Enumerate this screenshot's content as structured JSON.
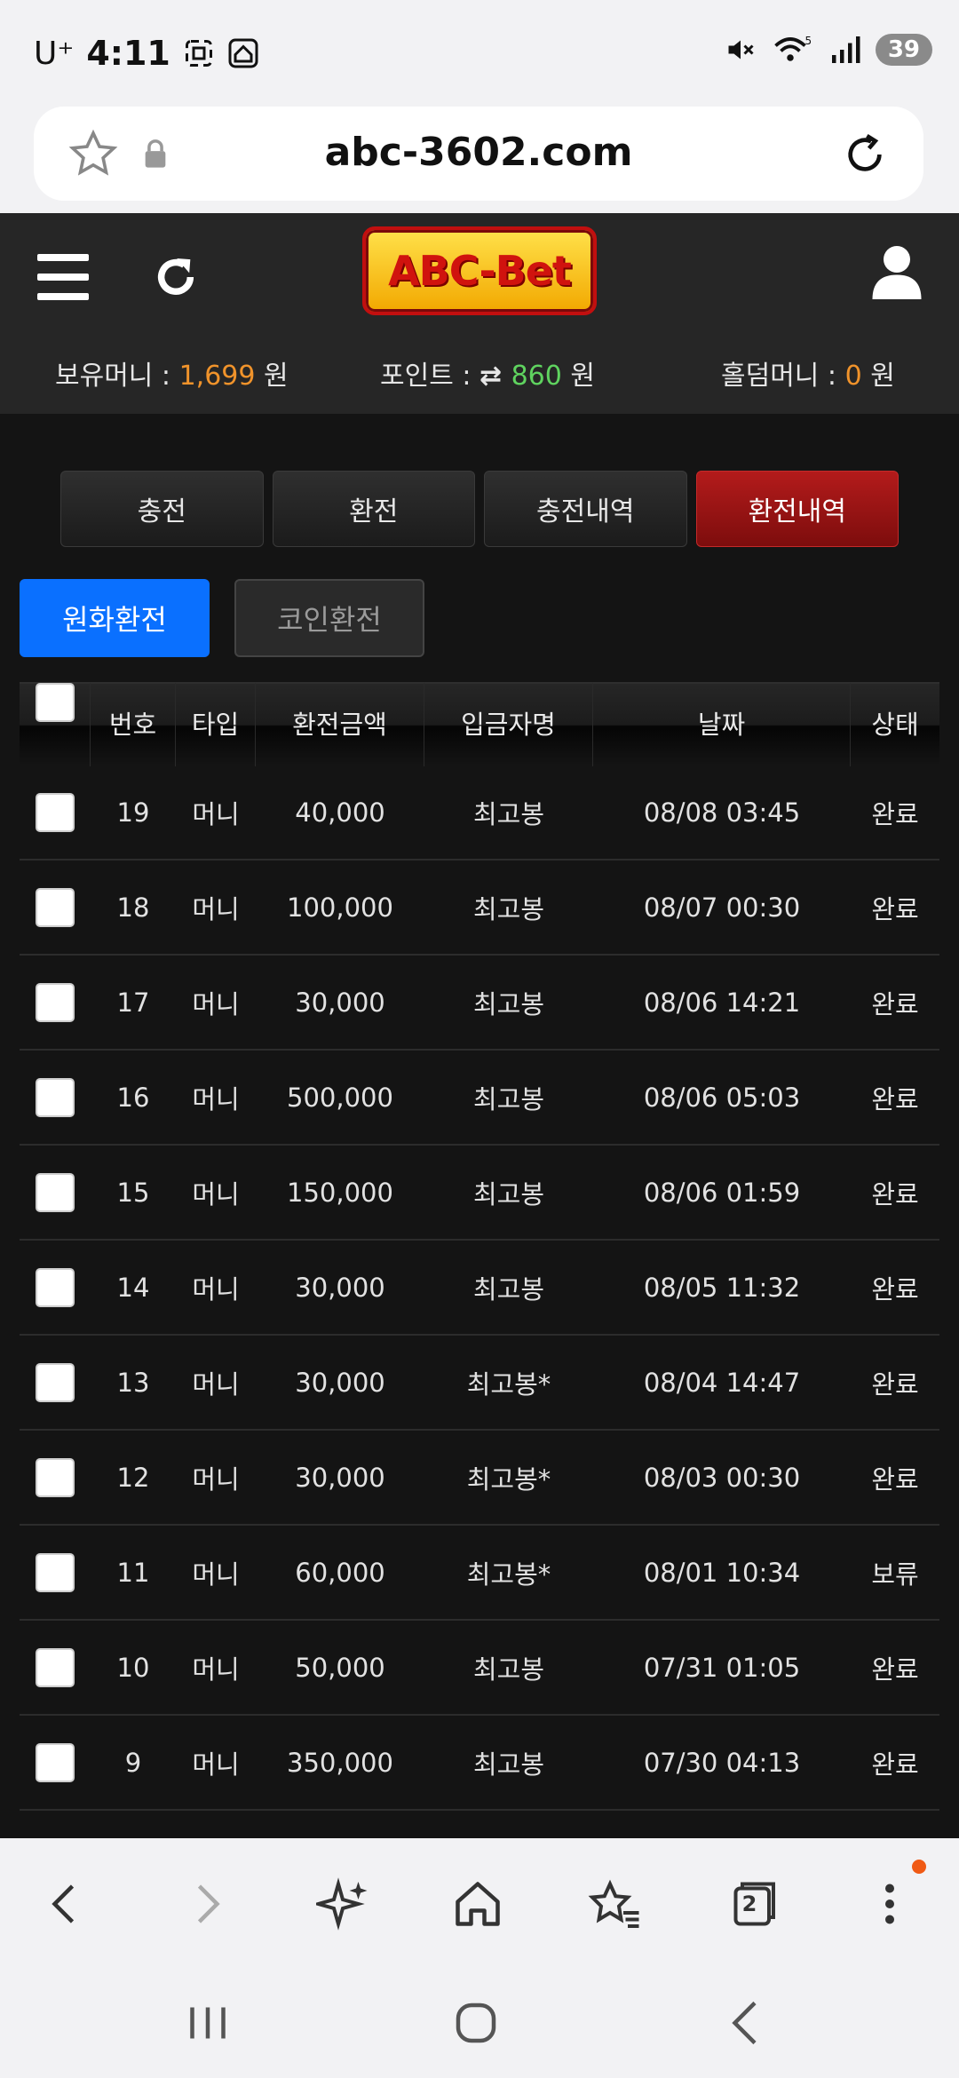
{
  "status_bar": {
    "carrier": "U⁺",
    "time": "4:11",
    "battery": "39"
  },
  "browser": {
    "url": "abc-3602.com"
  },
  "site": {
    "logo_text": "ABC-Bet",
    "balances": {
      "holding_label": "보유머니 : ",
      "holding_value": "1,699",
      "holding_unit": " 원",
      "point_label": "포인트 : ",
      "point_value": "860",
      "point_unit": " 원",
      "holdem_label": "홀덤머니 : ",
      "holdem_value": "0",
      "holdem_unit": " 원"
    },
    "tabs": [
      "충전",
      "환전",
      "충전내역",
      "환전내역"
    ],
    "active_tab": "환전내역",
    "subtabs": {
      "won": "원화환전",
      "coin": "코인환전"
    }
  },
  "table": {
    "headers": {
      "no": "번호",
      "type": "타입",
      "amount": "환전금액",
      "depositor": "입금자명",
      "date": "날짜",
      "status": "상태"
    },
    "rows": [
      {
        "no": "19",
        "type": "머니",
        "amount": "40,000",
        "name": "최고봉",
        "date": "08/08 03:45",
        "status": "완료"
      },
      {
        "no": "18",
        "type": "머니",
        "amount": "100,000",
        "name": "최고봉",
        "date": "08/07 00:30",
        "status": "완료"
      },
      {
        "no": "17",
        "type": "머니",
        "amount": "30,000",
        "name": "최고봉",
        "date": "08/06 14:21",
        "status": "완료"
      },
      {
        "no": "16",
        "type": "머니",
        "amount": "500,000",
        "name": "최고봉",
        "date": "08/06 05:03",
        "status": "완료"
      },
      {
        "no": "15",
        "type": "머니",
        "amount": "150,000",
        "name": "최고봉",
        "date": "08/06 01:59",
        "status": "완료"
      },
      {
        "no": "14",
        "type": "머니",
        "amount": "30,000",
        "name": "최고봉",
        "date": "08/05 11:32",
        "status": "완료"
      },
      {
        "no": "13",
        "type": "머니",
        "amount": "30,000",
        "name": "최고봉*",
        "date": "08/04 14:47",
        "status": "완료"
      },
      {
        "no": "12",
        "type": "머니",
        "amount": "30,000",
        "name": "최고봉*",
        "date": "08/03 00:30",
        "status": "완료"
      },
      {
        "no": "11",
        "type": "머니",
        "amount": "60,000",
        "name": "최고봉*",
        "date": "08/01 10:34",
        "status": "보류"
      },
      {
        "no": "10",
        "type": "머니",
        "amount": "50,000",
        "name": "최고봉",
        "date": "07/31 01:05",
        "status": "완료"
      },
      {
        "no": "9",
        "type": "머니",
        "amount": "350,000",
        "name": "최고봉",
        "date": "07/30 04:13",
        "status": "완료"
      }
    ]
  },
  "browser_nav": {
    "tab_count": "2"
  },
  "colors": {
    "accent_blue": "#0a70ff",
    "active_tab_red": "#b31b1b",
    "value_orange": "#f0932b",
    "value_green": "#5fd35f"
  }
}
